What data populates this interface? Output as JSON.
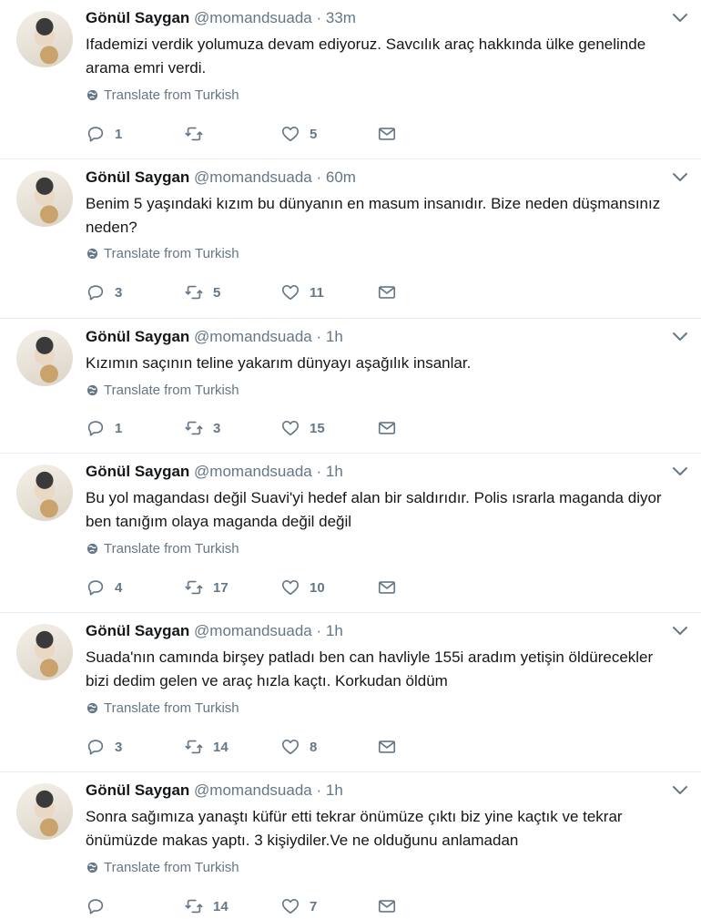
{
  "tweets": [
    {
      "name": "Gönül Saygan",
      "handle": "@momandsuada",
      "dot": "·",
      "time": "33m",
      "text": "Ifademizi verdik yolumuza devam ediyoruz. Savcılık araç hakkında ülke genelinde arama emri verdi.",
      "translate": "Translate from Turkish",
      "replies": "1",
      "retweets": "",
      "likes": "5"
    },
    {
      "name": "Gönül Saygan",
      "handle": "@momandsuada",
      "dot": "·",
      "time": "60m",
      "text": "Benim 5 yaşındaki kızım bu dünyanın en masum insanıdır. Bize neden düşmansınız neden?",
      "translate": "Translate from Turkish",
      "replies": "3",
      "retweets": "5",
      "likes": "11"
    },
    {
      "name": "Gönül Saygan",
      "handle": "@momandsuada",
      "dot": "·",
      "time": "1h",
      "text": "Kızımın saçının teline yakarım dünyayı aşağılık insanlar.",
      "translate": "Translate from Turkish",
      "replies": "1",
      "retweets": "3",
      "likes": "15"
    },
    {
      "name": "Gönül Saygan",
      "handle": "@momandsuada",
      "dot": "·",
      "time": "1h",
      "text": "Bu yol magandası değil Suavi'yi hedef alan bir saldırıdır. Polis ısrarla maganda diyor ben tanığım olaya maganda değil değil",
      "translate": "Translate from Turkish",
      "replies": "4",
      "retweets": "17",
      "likes": "10"
    },
    {
      "name": "Gönül Saygan",
      "handle": "@momandsuada",
      "dot": "·",
      "time": "1h",
      "text": "Suada'nın camında birşey patladı ben can havliyle 155i aradım yetişin öldürecekler bizi dedim gelen ve araç hızla kaçtı. Korkudan öldüm",
      "translate": "Translate from Turkish",
      "replies": "3",
      "retweets": "14",
      "likes": "8"
    },
    {
      "name": "Gönül Saygan",
      "handle": "@momandsuada",
      "dot": "·",
      "time": "1h",
      "text": "Sonra sağımıza yanaştı küfür etti tekrar önümüze çıktı biz yine kaçtık ve tekrar önümüzde makas yaptı. 3 kişiydiler.Ve ne olduğunu anlamadan",
      "translate": "Translate from Turkish",
      "replies": "",
      "retweets": "14",
      "likes": "7"
    }
  ],
  "icons": {
    "reply": "reply-icon",
    "retweet": "retweet-icon",
    "like": "heart-icon",
    "message": "envelope-icon",
    "globe": "globe-icon",
    "caret": "chevron-down-icon"
  },
  "colors": {
    "text": "#14171a",
    "secondary": "#657786",
    "divider": "#e6ecf0"
  }
}
